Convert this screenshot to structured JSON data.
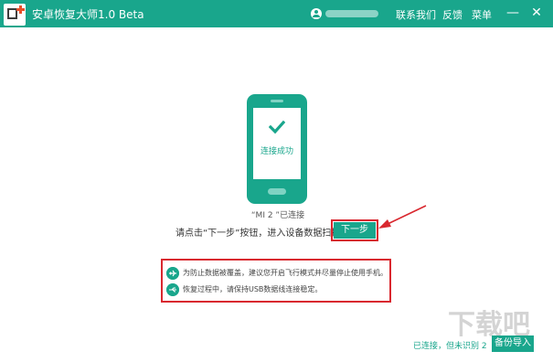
{
  "app": {
    "title": "安卓恢复大师1.0 Beta"
  },
  "header": {
    "links": [
      "联系我们",
      "反馈",
      "菜单"
    ]
  },
  "window_controls": {
    "minimize": "—",
    "close": "✕"
  },
  "phone": {
    "status_text": "连接成功"
  },
  "device": {
    "status": "“MI 2 ”已连接"
  },
  "instruction": {
    "text": "请点击“下一步”按钮，进入设备数据扫描"
  },
  "next_button": {
    "label": "下一步"
  },
  "tips": [
    {
      "icon": "airplane-icon",
      "text": "为防止数据被覆盖，建议您开启飞行模式并尽量停止使用手机。"
    },
    {
      "icon": "usb-icon",
      "text": "恢复过程中，请保持USB数据线连接稳定。"
    }
  ],
  "footer": {
    "status": "已连接，但未识别 2",
    "backup_button": "备份导入"
  },
  "watermark": {
    "text": "下载吧"
  },
  "colors": {
    "accent": "#19a68c",
    "highlight": "#d9282f"
  }
}
